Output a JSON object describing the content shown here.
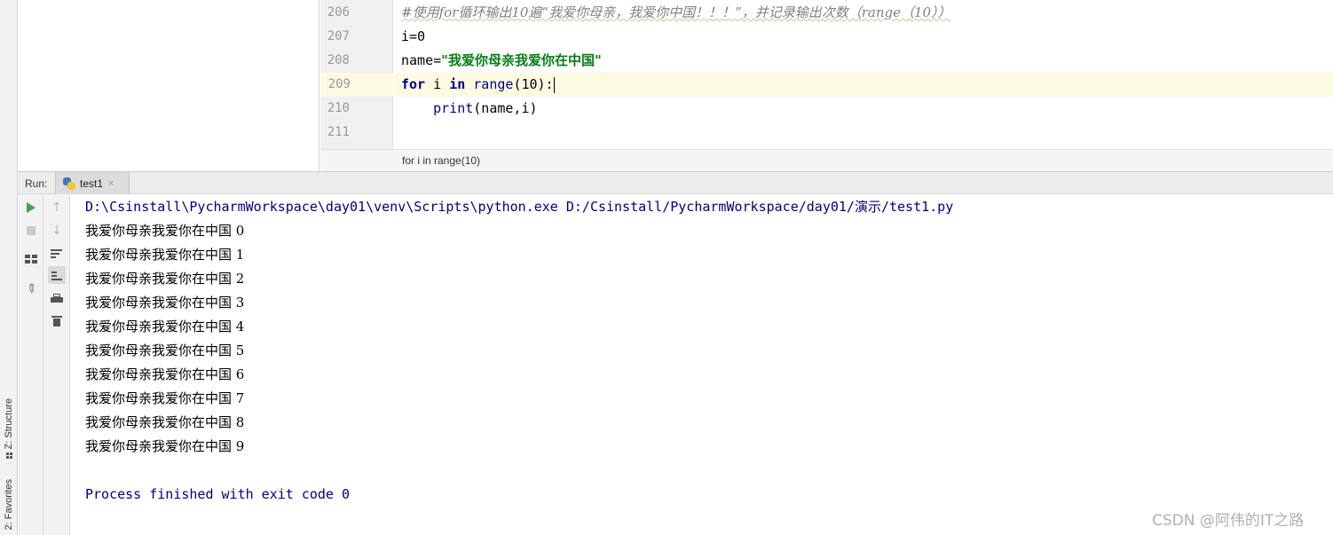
{
  "left_stripe": {
    "tabs": [
      {
        "label": "Z: Structure",
        "icon": "structure-icon"
      },
      {
        "label": "2: Favorites",
        "icon": "favorites-icon"
      }
    ]
  },
  "editor": {
    "lines": [
      {
        "num": "206"
      },
      {
        "num": "207"
      },
      {
        "num": "208"
      },
      {
        "num": "209"
      },
      {
        "num": "210"
      },
      {
        "num": "211"
      }
    ],
    "code": {
      "l206_comment": "#使用for循环输出10遍“我爱你母亲，我爱你中国！！！”，并记录输出次数（range（10））",
      "l207": "i=0",
      "l208_prefix": "name=",
      "l208_string": "\"我爱你母亲我爱你在中国\"",
      "l209_for": "for",
      "l209_mid": " i ",
      "l209_in": "in",
      "l209_space": " ",
      "l209_range": "range",
      "l209_rest": "(10):",
      "l210_indent": "    ",
      "l210_print": "print",
      "l210_rest": "(name,i)"
    },
    "breadcrumb": "for i in range(10)",
    "current_line_color": "#fcfae1"
  },
  "run": {
    "label": "Run:",
    "tab": {
      "label": "test1",
      "close": "×",
      "icon": "python-icon"
    },
    "toolbar_left": [
      "run-icon",
      "stop-icon",
      "layout-icon",
      "pin-icon"
    ],
    "toolbar_right": [
      "arrow-up-icon",
      "arrow-down-icon",
      "soft-wrap-icon",
      "scroll-to-end-icon",
      "print-icon",
      "trash-icon"
    ]
  },
  "console": {
    "command": "D:\\Csinstall\\PycharmWorkspace\\day01\\venv\\Scripts\\python.exe D:/Csinstall/PycharmWorkspace/day01/演示/test1.py",
    "output": [
      "我爱你母亲我爱你在中国 0",
      "我爱你母亲我爱你在中国 1",
      "我爱你母亲我爱你在中国 2",
      "我爱你母亲我爱你在中国 3",
      "我爱你母亲我爱你在中国 4",
      "我爱你母亲我爱你在中国 5",
      "我爱你母亲我爱你在中国 6",
      "我爱你母亲我爱你在中国 7",
      "我爱你母亲我爱你在中国 8",
      "我爱你母亲我爱你在中国 9"
    ],
    "exit_message": "Process finished with exit code 0"
  },
  "watermark": "CSDN @阿伟的IT之路"
}
